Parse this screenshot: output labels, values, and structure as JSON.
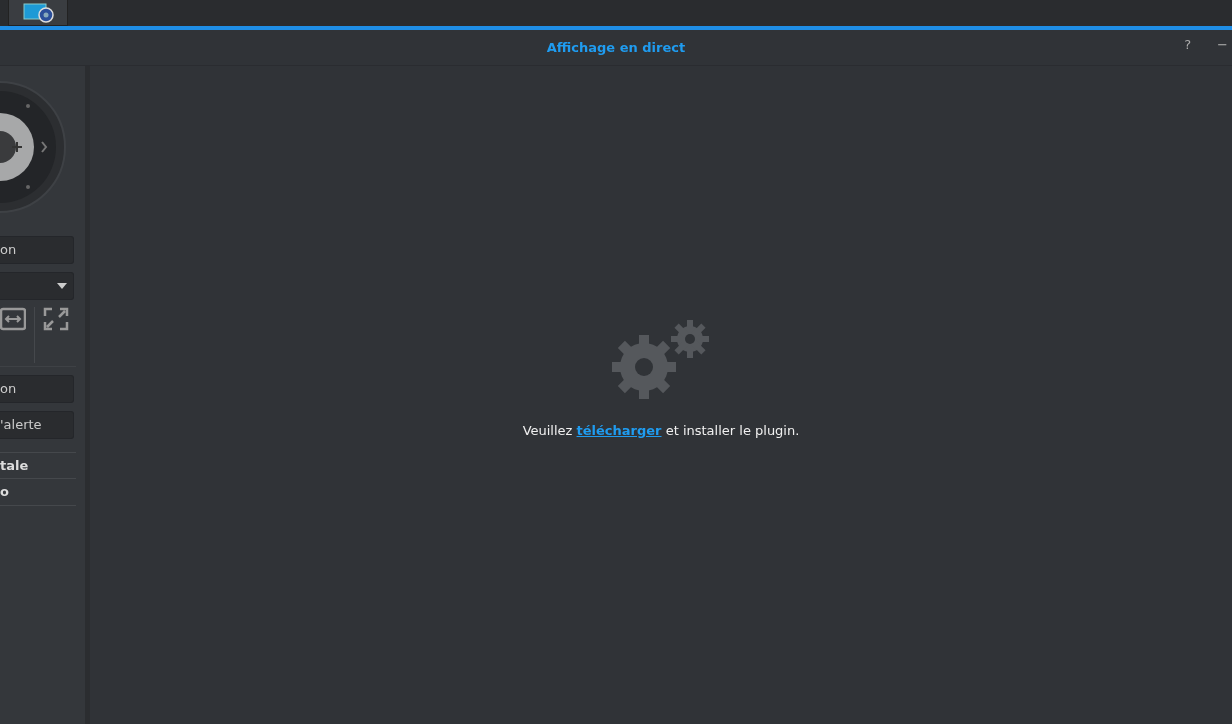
{
  "window": {
    "title": "Affichage en direct",
    "controls": [
      "?",
      "−"
    ]
  },
  "sidebar": {
    "buttons": [
      {
        "label": "on",
        "kind": "button"
      },
      {
        "kind": "dropdown"
      }
    ],
    "buttons2": [
      {
        "label": "on"
      },
      {
        "label": "'alerte"
      }
    ],
    "items": [
      {
        "label": "tale"
      },
      {
        "label": "o"
      }
    ]
  },
  "message": {
    "before": "Veuillez ",
    "link": "télécharger",
    "after": " et installer le plugin."
  }
}
